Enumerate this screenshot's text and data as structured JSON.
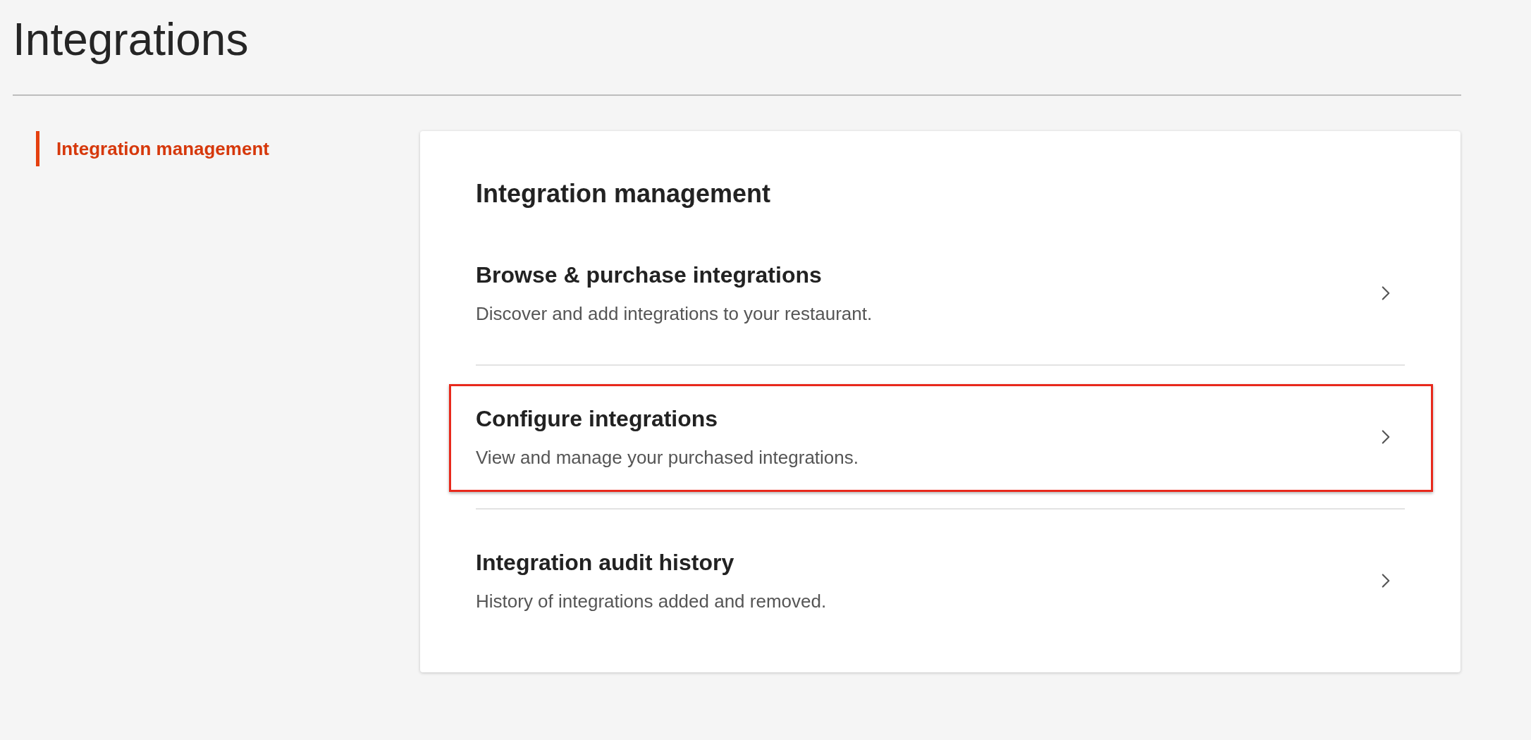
{
  "page_title": "Integrations",
  "sidebar": {
    "items": [
      {
        "label": "Integration management",
        "selected": true
      }
    ]
  },
  "card": {
    "title": "Integration management",
    "items": [
      {
        "title": "Browse & purchase integrations",
        "description": "Discover and add integrations to your restaurant.",
        "highlighted": false
      },
      {
        "title": "Configure integrations",
        "description": "View and manage your purchased integrations.",
        "highlighted": true
      },
      {
        "title": "Integration audit history",
        "description": "History of integrations added and removed.",
        "highlighted": false
      }
    ]
  }
}
